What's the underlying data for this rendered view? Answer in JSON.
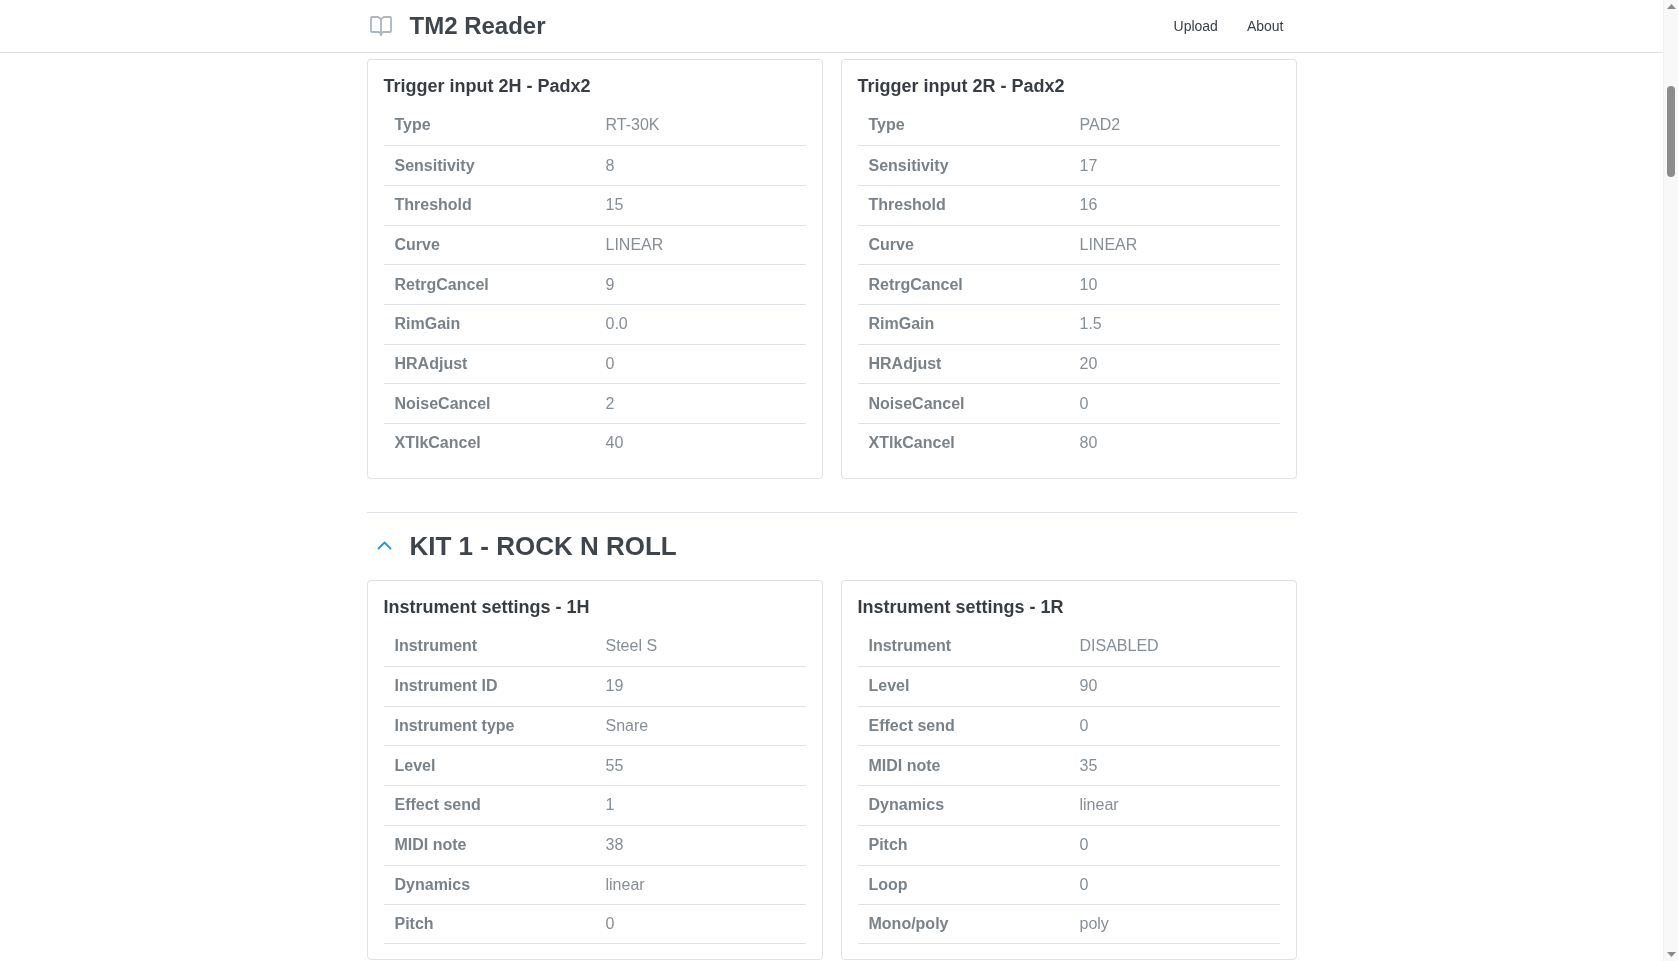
{
  "header": {
    "title": "TM2 Reader",
    "nav_links": [
      "Upload",
      "About"
    ]
  },
  "sections": [
    {
      "cards": [
        {
          "title": "Trigger input 2H - Padx2",
          "continues_below": false,
          "rows": [
            {
              "label": "Type",
              "value": "RT-30K"
            },
            {
              "label": "Sensitivity",
              "value": "8"
            },
            {
              "label": "Threshold",
              "value": "15"
            },
            {
              "label": "Curve",
              "value": "LINEAR"
            },
            {
              "label": "RetrgCancel",
              "value": "9"
            },
            {
              "label": "RimGain",
              "value": "0.0"
            },
            {
              "label": "HRAdjust",
              "value": "0"
            },
            {
              "label": "NoiseCancel",
              "value": "2"
            },
            {
              "label": "XTlkCancel",
              "value": "40"
            }
          ]
        },
        {
          "title": "Trigger input 2R - Padx2",
          "continues_below": false,
          "rows": [
            {
              "label": "Type",
              "value": "PAD2"
            },
            {
              "label": "Sensitivity",
              "value": "17"
            },
            {
              "label": "Threshold",
              "value": "16"
            },
            {
              "label": "Curve",
              "value": "LINEAR"
            },
            {
              "label": "RetrgCancel",
              "value": "10"
            },
            {
              "label": "RimGain",
              "value": "1.5"
            },
            {
              "label": "HRAdjust",
              "value": "20"
            },
            {
              "label": "NoiseCancel",
              "value": "0"
            },
            {
              "label": "XTlkCancel",
              "value": "80"
            }
          ]
        }
      ]
    },
    {
      "title": "KIT 1 - ROCK N ROLL",
      "expanded": true,
      "cards": [
        {
          "title": "Instrument settings - 1H",
          "continues_below": true,
          "rows": [
            {
              "label": "Instrument",
              "value": "Steel S"
            },
            {
              "label": "Instrument ID",
              "value": "19"
            },
            {
              "label": "Instrument type",
              "value": "Snare"
            },
            {
              "label": "Level",
              "value": "55"
            },
            {
              "label": "Effect send",
              "value": "1"
            },
            {
              "label": "MIDI note",
              "value": "38"
            },
            {
              "label": "Dynamics",
              "value": "linear"
            },
            {
              "label": "Pitch",
              "value": "0"
            }
          ]
        },
        {
          "title": "Instrument settings - 1R",
          "continues_below": true,
          "rows": [
            {
              "label": "Instrument",
              "value": "DISABLED"
            },
            {
              "label": "Level",
              "value": "90"
            },
            {
              "label": "Effect send",
              "value": "0"
            },
            {
              "label": "MIDI note",
              "value": "35"
            },
            {
              "label": "Dynamics",
              "value": "linear"
            },
            {
              "label": "Pitch",
              "value": "0"
            },
            {
              "label": "Loop",
              "value": "0"
            },
            {
              "label": "Mono/poly",
              "value": "poly"
            }
          ]
        }
      ]
    }
  ]
}
